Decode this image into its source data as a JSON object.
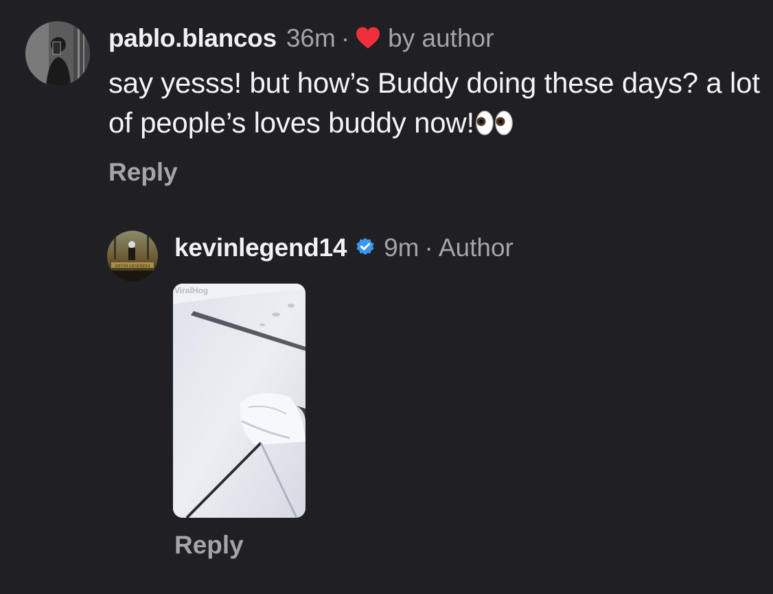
{
  "comments": [
    {
      "username": "pablo.blancos",
      "time": "36m",
      "separator": "·",
      "liked_by_author_label": "by author",
      "text": "say yesss! but how’s Buddy doing these days? a lot of people’s loves buddy now!",
      "emoji": "eyes",
      "reply_label": "Reply",
      "avatar_icon": "avatar-photo"
    },
    {
      "username": "kevinlegend14",
      "verified": true,
      "time": "9m",
      "separator": "·",
      "author_label": "Author",
      "media": {
        "type": "video-thumbnail",
        "watermark": "ViralHog",
        "description_icon": "snow-video"
      },
      "reply_label": "Reply",
      "avatar_icon": "avatar-poster",
      "avatar_caption": "KEVIN LEGEND14"
    }
  ],
  "colors": {
    "background": "#1f1f24",
    "primary_text": "#f2f2f2",
    "secondary_text": "#a4a4aa",
    "heart": "#ef2f3c",
    "verified": "#3897f0"
  }
}
